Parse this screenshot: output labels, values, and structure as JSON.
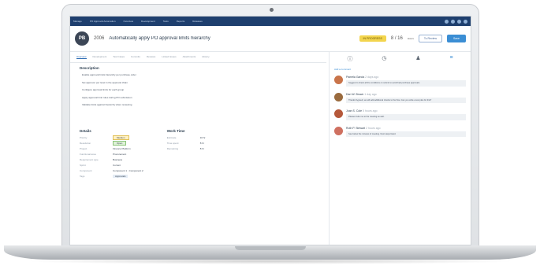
{
  "nav": {
    "items": [
      "Manage",
      "PO Approval Automation",
      "Overview",
      "Development",
      "Tests",
      "Reports",
      "Releases"
    ]
  },
  "issue": {
    "avatar_initials": "PB",
    "id": "2006",
    "title": "Automatically apply PO approval limits hierarchy",
    "status": "IN PROGRESS",
    "estimate": "8 / 16",
    "estimate_sub": "Hours",
    "transition": "To Review",
    "save": "Save"
  },
  "tabs": [
    "Overview",
    "Development",
    "Test Cases",
    "Commits",
    "Reviews",
    "Linked Issues",
    "Attachments",
    "History"
  ],
  "description": {
    "title": "Description",
    "lines": [
      "Enable approval limits hierarchy per purchase order",
      "Set approver per level in the approval chain",
      "Configure approval limits for each group",
      "Apply approval limit rules during PO submission",
      "Validate limits against hierarchy when reviewing"
    ]
  },
  "details": {
    "title": "Details",
    "fields": [
      {
        "k": "Priority",
        "v": "Medium"
      },
      {
        "k": "Resolution",
        "v": "Open"
      },
      {
        "k": "Project",
        "v": "Finance Platform"
      },
      {
        "k": "Functional area",
        "v": "Procurement"
      },
      {
        "k": "Requirement type",
        "v": "Business"
      },
      {
        "k": "Sprint",
        "v": "Current"
      },
      {
        "k": "Component",
        "v": "Component 1 · Component 2"
      },
      {
        "k": "Tags",
        "v": "Approvals"
      }
    ]
  },
  "time": {
    "title": "Work Time",
    "fields": [
      {
        "k": "Estimate",
        "v": "16 hr"
      },
      {
        "k": "Time spent",
        "v": "8 hr"
      },
      {
        "k": "Remaining",
        "v": "8 hr"
      }
    ]
  },
  "panel": {
    "link": "Add a comment",
    "comments": [
      {
        "name": "Pamela Garcia",
        "time": "2 days ago",
        "color": "#c9744a",
        "text": "Suggest to check all the conditions on submit to avoid bad purchase approvals."
      },
      {
        "name": "Dan W. Brown",
        "time": "1 day ago",
        "color": "#9a6b3e",
        "text": "Thanks! Agreed, we will add additional checks to the flow. Can you write a test plan for this?"
      },
      {
        "name": "Joan S. Cole",
        "time": "5 hours ago",
        "color": "#b5583a",
        "text": "Please invite me to the meeting as well."
      },
      {
        "name": "Ruth P. Stewart",
        "time": "2 hours ago",
        "color": "#cf7060",
        "text": "See below the minutes of meeting. Next steps listed."
      }
    ]
  }
}
